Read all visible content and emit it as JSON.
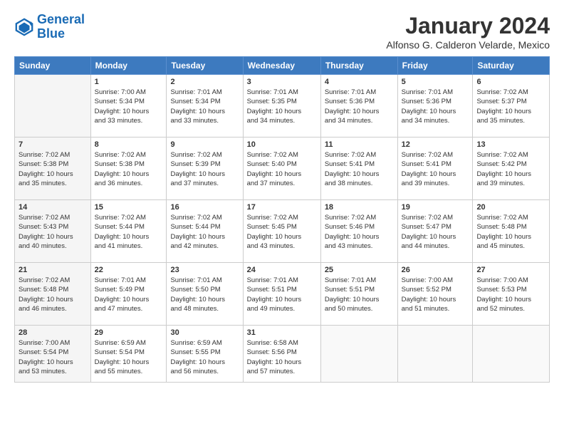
{
  "logo": {
    "line1": "General",
    "line2": "Blue"
  },
  "title": "January 2024",
  "subtitle": "Alfonso G. Calderon Velarde, Mexico",
  "days_of_week": [
    "Sunday",
    "Monday",
    "Tuesday",
    "Wednesday",
    "Thursday",
    "Friday",
    "Saturday"
  ],
  "weeks": [
    [
      {
        "num": "",
        "info": ""
      },
      {
        "num": "1",
        "info": "Sunrise: 7:00 AM\nSunset: 5:34 PM\nDaylight: 10 hours\nand 33 minutes."
      },
      {
        "num": "2",
        "info": "Sunrise: 7:01 AM\nSunset: 5:34 PM\nDaylight: 10 hours\nand 33 minutes."
      },
      {
        "num": "3",
        "info": "Sunrise: 7:01 AM\nSunset: 5:35 PM\nDaylight: 10 hours\nand 34 minutes."
      },
      {
        "num": "4",
        "info": "Sunrise: 7:01 AM\nSunset: 5:36 PM\nDaylight: 10 hours\nand 34 minutes."
      },
      {
        "num": "5",
        "info": "Sunrise: 7:01 AM\nSunset: 5:36 PM\nDaylight: 10 hours\nand 34 minutes."
      },
      {
        "num": "6",
        "info": "Sunrise: 7:02 AM\nSunset: 5:37 PM\nDaylight: 10 hours\nand 35 minutes."
      }
    ],
    [
      {
        "num": "7",
        "info": "Sunrise: 7:02 AM\nSunset: 5:38 PM\nDaylight: 10 hours\nand 35 minutes."
      },
      {
        "num": "8",
        "info": "Sunrise: 7:02 AM\nSunset: 5:38 PM\nDaylight: 10 hours\nand 36 minutes."
      },
      {
        "num": "9",
        "info": "Sunrise: 7:02 AM\nSunset: 5:39 PM\nDaylight: 10 hours\nand 37 minutes."
      },
      {
        "num": "10",
        "info": "Sunrise: 7:02 AM\nSunset: 5:40 PM\nDaylight: 10 hours\nand 37 minutes."
      },
      {
        "num": "11",
        "info": "Sunrise: 7:02 AM\nSunset: 5:41 PM\nDaylight: 10 hours\nand 38 minutes."
      },
      {
        "num": "12",
        "info": "Sunrise: 7:02 AM\nSunset: 5:41 PM\nDaylight: 10 hours\nand 39 minutes."
      },
      {
        "num": "13",
        "info": "Sunrise: 7:02 AM\nSunset: 5:42 PM\nDaylight: 10 hours\nand 39 minutes."
      }
    ],
    [
      {
        "num": "14",
        "info": "Sunrise: 7:02 AM\nSunset: 5:43 PM\nDaylight: 10 hours\nand 40 minutes."
      },
      {
        "num": "15",
        "info": "Sunrise: 7:02 AM\nSunset: 5:44 PM\nDaylight: 10 hours\nand 41 minutes."
      },
      {
        "num": "16",
        "info": "Sunrise: 7:02 AM\nSunset: 5:44 PM\nDaylight: 10 hours\nand 42 minutes."
      },
      {
        "num": "17",
        "info": "Sunrise: 7:02 AM\nSunset: 5:45 PM\nDaylight: 10 hours\nand 43 minutes."
      },
      {
        "num": "18",
        "info": "Sunrise: 7:02 AM\nSunset: 5:46 PM\nDaylight: 10 hours\nand 43 minutes."
      },
      {
        "num": "19",
        "info": "Sunrise: 7:02 AM\nSunset: 5:47 PM\nDaylight: 10 hours\nand 44 minutes."
      },
      {
        "num": "20",
        "info": "Sunrise: 7:02 AM\nSunset: 5:48 PM\nDaylight: 10 hours\nand 45 minutes."
      }
    ],
    [
      {
        "num": "21",
        "info": "Sunrise: 7:02 AM\nSunset: 5:48 PM\nDaylight: 10 hours\nand 46 minutes."
      },
      {
        "num": "22",
        "info": "Sunrise: 7:01 AM\nSunset: 5:49 PM\nDaylight: 10 hours\nand 47 minutes."
      },
      {
        "num": "23",
        "info": "Sunrise: 7:01 AM\nSunset: 5:50 PM\nDaylight: 10 hours\nand 48 minutes."
      },
      {
        "num": "24",
        "info": "Sunrise: 7:01 AM\nSunset: 5:51 PM\nDaylight: 10 hours\nand 49 minutes."
      },
      {
        "num": "25",
        "info": "Sunrise: 7:01 AM\nSunset: 5:51 PM\nDaylight: 10 hours\nand 50 minutes."
      },
      {
        "num": "26",
        "info": "Sunrise: 7:00 AM\nSunset: 5:52 PM\nDaylight: 10 hours\nand 51 minutes."
      },
      {
        "num": "27",
        "info": "Sunrise: 7:00 AM\nSunset: 5:53 PM\nDaylight: 10 hours\nand 52 minutes."
      }
    ],
    [
      {
        "num": "28",
        "info": "Sunrise: 7:00 AM\nSunset: 5:54 PM\nDaylight: 10 hours\nand 53 minutes."
      },
      {
        "num": "29",
        "info": "Sunrise: 6:59 AM\nSunset: 5:54 PM\nDaylight: 10 hours\nand 55 minutes."
      },
      {
        "num": "30",
        "info": "Sunrise: 6:59 AM\nSunset: 5:55 PM\nDaylight: 10 hours\nand 56 minutes."
      },
      {
        "num": "31",
        "info": "Sunrise: 6:58 AM\nSunset: 5:56 PM\nDaylight: 10 hours\nand 57 minutes."
      },
      {
        "num": "",
        "info": ""
      },
      {
        "num": "",
        "info": ""
      },
      {
        "num": "",
        "info": ""
      }
    ]
  ]
}
